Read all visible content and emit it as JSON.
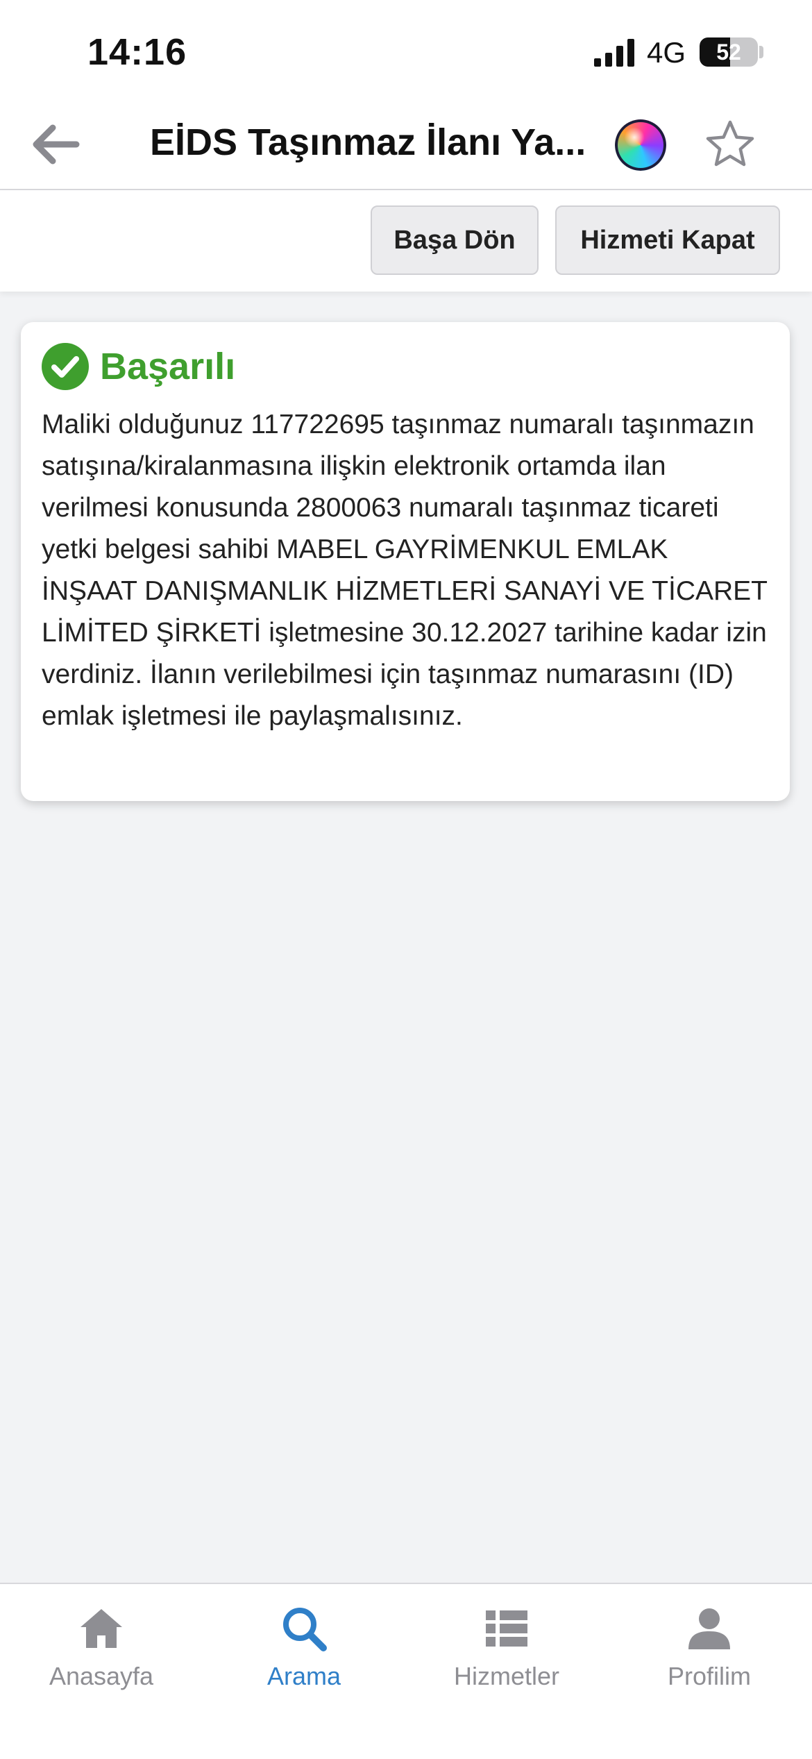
{
  "status_bar": {
    "time": "14:16",
    "network": "4G",
    "battery_level": "52"
  },
  "header": {
    "title": "EİDS Taşınmaz İlanı Ya..."
  },
  "toolbar": {
    "back_home_label": "Başa Dön",
    "close_service_label": "Hizmeti Kapat"
  },
  "result": {
    "title": "Başarılı",
    "message": "Maliki olduğunuz 117722695 taşınmaz numaralı taşınmazın satışına/kiralanmasına ilişkin elektronik ortamda ilan verilmesi konusunda 2800063 numaralı taşınmaz ticareti yetki belgesi sahibi MABEL GAYRİMENKUL EMLAK İNŞAAT DANIŞMANLIK HİZMETLERİ SANAYİ VE TİCARET LİMİTED ŞİRKETİ işletmesine 30.12.2027 tarihine kadar izin verdiniz. İlanın verilebilmesi için taşınmaz numarasını (ID) emlak işletmesi ile paylaşmalısınız."
  },
  "tabs": [
    {
      "label": "Anasayfa",
      "icon": "home-icon",
      "active": false
    },
    {
      "label": "Arama",
      "icon": "search-icon",
      "active": true
    },
    {
      "label": "Hizmetler",
      "icon": "list-icon",
      "active": false
    },
    {
      "label": "Profilim",
      "icon": "profile-icon",
      "active": false
    }
  ],
  "colors": {
    "success": "#3f9f2e",
    "accent": "#2f7fc8",
    "inactive_tab": "#8e8e93"
  }
}
